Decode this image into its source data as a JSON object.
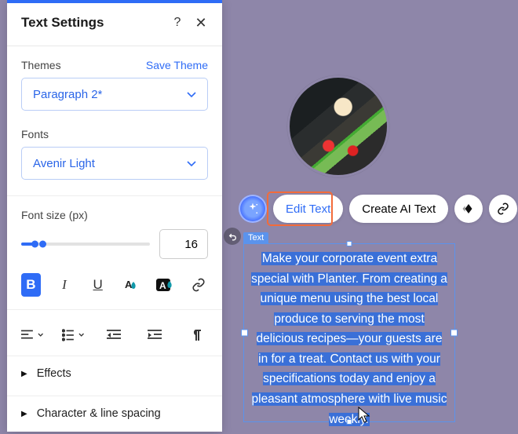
{
  "panel": {
    "title": "Text Settings",
    "themes": {
      "label": "Themes",
      "save_link": "Save Theme",
      "selected": "Paragraph 2*"
    },
    "fonts": {
      "label": "Fonts",
      "selected": "Avenir Light"
    },
    "fontsize": {
      "label": "Font size (px)",
      "value": "16"
    },
    "accordion": {
      "effects": "Effects",
      "char_spacing": "Character & line spacing"
    }
  },
  "toolbar": {
    "edit_text": "Edit Text",
    "create_ai": "Create AI Text"
  },
  "textbox": {
    "label": "Text",
    "content": "Make your corporate event extra special with Planter. From creating a unique menu using the best local produce to serving the most delicious recipes—your guests are in for a treat. Contact us with your specifications today and enjoy a pleasant atmosphere with live music weekly."
  }
}
